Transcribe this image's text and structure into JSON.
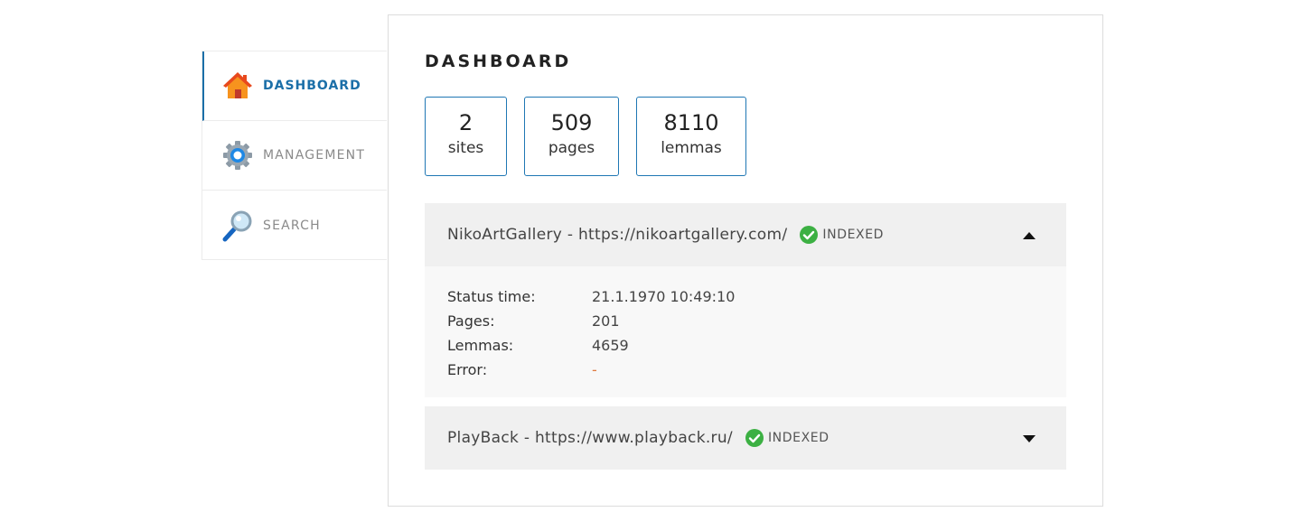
{
  "sidebar": {
    "items": [
      {
        "label": "DASHBOARD",
        "icon": "home-icon",
        "active": true
      },
      {
        "label": "MANAGEMENT",
        "icon": "gear-icon",
        "active": false
      },
      {
        "label": "SEARCH",
        "icon": "magnifier-icon",
        "active": false
      }
    ]
  },
  "main": {
    "title": "DASHBOARD",
    "stats": [
      {
        "value": "2",
        "label": "sites"
      },
      {
        "value": "509",
        "label": "pages"
      },
      {
        "value": "8110",
        "label": "lemmas"
      }
    ],
    "sites": [
      {
        "name": "NikoArtGallery - https://nikoartgallery.com/",
        "status": "INDEXED",
        "expanded": true,
        "details": [
          {
            "key": "Status time:",
            "value": "21.1.1970 10:49:10"
          },
          {
            "key": "Pages:",
            "value": "201"
          },
          {
            "key": "Lemmas:",
            "value": "4659"
          },
          {
            "key": "Error:",
            "value": "-"
          }
        ]
      },
      {
        "name": "PlayBack - https://www.playback.ru/",
        "status": "INDEXED",
        "expanded": false
      }
    ]
  },
  "colors": {
    "accent": "#1b6fa8",
    "stat_border": "#1f77b4",
    "status_ok": "#3cb043",
    "error_value": "#e07a3f",
    "header_bg": "#f0f0f0",
    "details_bg": "#f8f8f8"
  }
}
